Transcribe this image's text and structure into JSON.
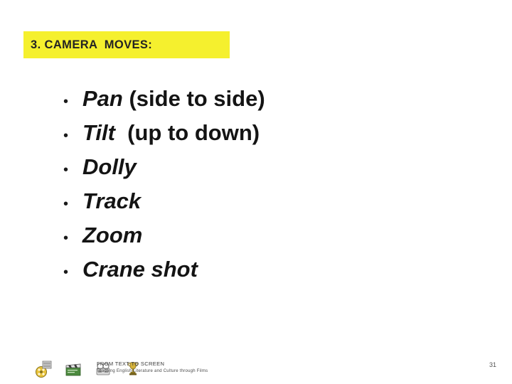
{
  "slide": {
    "title": "3. CAMERA  MOVES:",
    "title_banner_color": "#f5f02e",
    "bullets": [
      {
        "marker": "•",
        "emphasis": "Pan",
        "rest": " (side to side)"
      },
      {
        "marker": "•",
        "emphasis": "Tilt",
        "rest": "  (up to down)"
      },
      {
        "marker": "•",
        "emphasis": "Dolly",
        "rest": ""
      },
      {
        "marker": "•",
        "emphasis": "Track",
        "rest": ""
      },
      {
        "marker": "•",
        "emphasis": "Zoom",
        "rest": ""
      },
      {
        "marker": "•",
        "emphasis": "Crane shot",
        "rest": ""
      }
    ],
    "footer": {
      "line1": "FROM TEXT TO SCREEN",
      "line2": "Teaching English Literature and Culture through Films",
      "page_number": "31",
      "icons": [
        "film-reel-icon",
        "clapperboard-icon",
        "projector-icon",
        "award-trophy-icon"
      ]
    }
  }
}
